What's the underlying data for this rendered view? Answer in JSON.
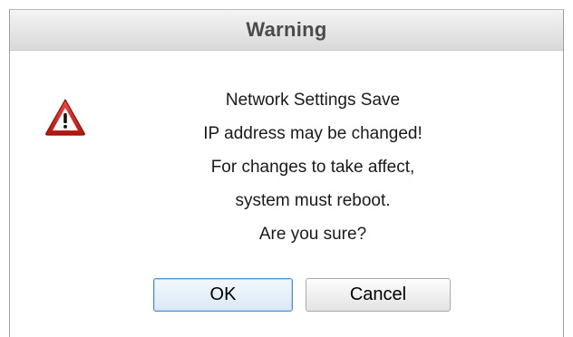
{
  "dialog": {
    "title": "Warning",
    "icon": "warning-triangle-icon",
    "message_lines": [
      "Network Settings Save",
      "IP address may be changed!",
      "For changes to take affect,",
      "system must reboot.",
      "Are you sure?"
    ],
    "buttons": {
      "ok_label": "OK",
      "cancel_label": "Cancel"
    },
    "colors": {
      "icon_red": "#c8231c",
      "focus_border": "#4a90d6"
    }
  }
}
